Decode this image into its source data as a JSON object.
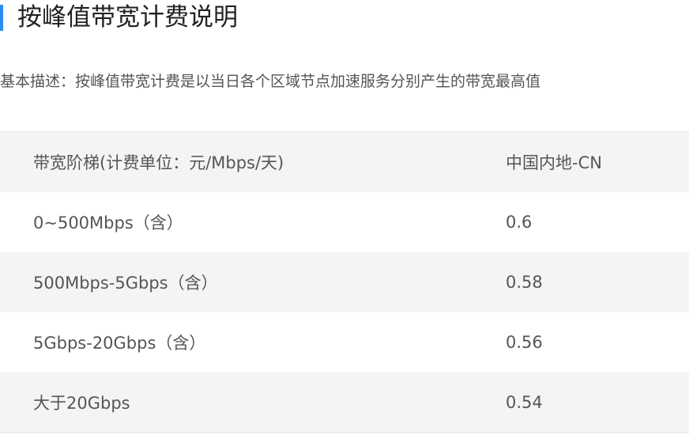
{
  "header": {
    "title": "按峰值带宽计费说明"
  },
  "description": "基本描述：按峰值带宽计费是以当日各个区域节点加速服务分别产生的带宽最高值",
  "table": {
    "headers": [
      "带宽阶梯(计费单位：元/Mbps/天)",
      "中国内地-CN"
    ],
    "rows": [
      [
        "0~500Mbps（含）",
        "0.6"
      ],
      [
        "500Mbps-5Gbps（含）",
        "0.58"
      ],
      [
        "5Gbps-20Gbps（含）",
        "0.56"
      ],
      [
        "大于20Gbps",
        "0.54"
      ]
    ]
  },
  "colors": {
    "accent": "#2d8cf0",
    "row_shade": "#f4f4f4"
  }
}
